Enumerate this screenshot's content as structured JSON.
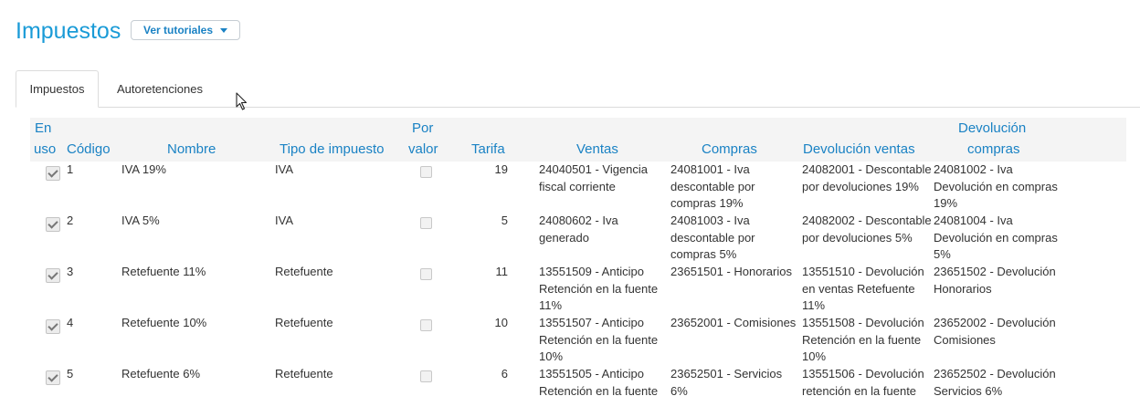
{
  "header": {
    "title": "Impuestos",
    "tutorials_label": "Ver tutoriales"
  },
  "tabs": [
    {
      "label": "Impuestos",
      "active": true
    },
    {
      "label": "Autoretenciones",
      "active": false
    }
  ],
  "table": {
    "columns": {
      "en_uso_1": "En",
      "en_uso_2": "uso",
      "codigo": "Código",
      "nombre": "Nombre",
      "tipo": "Tipo de impuesto",
      "por_valor_1": "Por",
      "por_valor_2": "valor",
      "tarifa": "Tarifa",
      "ventas": "Ventas",
      "compras": "Compras",
      "dev_ventas": "Devolución ventas",
      "dev_compras_1": "Devolución",
      "dev_compras_2": "compras"
    },
    "rows": [
      {
        "en_uso": true,
        "codigo": "1",
        "nombre": "IVA 19%",
        "tipo": "IVA",
        "por_valor": false,
        "tarifa": "19",
        "ventas": "24040501 - Vigencia fiscal corriente",
        "compras": "24081001 - Iva descontable por compras 19%",
        "dev_ventas": "24082001 - Descontable por devoluciones 19%",
        "dev_compras": "24081002 - Iva Devolución en compras 19%"
      },
      {
        "en_uso": true,
        "codigo": "2",
        "nombre": "IVA 5%",
        "tipo": "IVA",
        "por_valor": false,
        "tarifa": "5",
        "ventas": "24080602 - Iva generado",
        "compras": "24081003 - Iva descontable por compras 5%",
        "dev_ventas": "24082002 - Descontable por devoluciones 5%",
        "dev_compras": "24081004 - Iva Devolución en compras 5%"
      },
      {
        "en_uso": true,
        "codigo": "3",
        "nombre": "Retefuente 11%",
        "tipo": "Retefuente",
        "por_valor": false,
        "tarifa": "11",
        "ventas": "13551509 - Anticipo Retención en la fuente 11%",
        "compras": "23651501 - Honorarios",
        "dev_ventas": "13551510 - Devolución en ventas Retefuente 11%",
        "dev_compras": "23651502 - Devolución Honorarios"
      },
      {
        "en_uso": true,
        "codigo": "4",
        "nombre": "Retefuente 10%",
        "tipo": "Retefuente",
        "por_valor": false,
        "tarifa": "10",
        "ventas": "13551507 - Anticipo Retención en la fuente 10%",
        "compras": "23652001 - Comisiones",
        "dev_ventas": "13551508 - Devolución Retención en la fuente 10%",
        "dev_compras": "23652002 - Devolución Comisiones"
      },
      {
        "en_uso": true,
        "codigo": "5",
        "nombre": "Retefuente 6%",
        "tipo": "Retefuente",
        "por_valor": false,
        "tarifa": "6",
        "ventas": "13551505 - Anticipo Retención en la fuente",
        "compras": "23652501 - Servicios 6%",
        "dev_ventas": "13551506 - Devolución retención en la fuente",
        "dev_compras": "23652502 - Devolución Servicios 6%"
      }
    ]
  }
}
